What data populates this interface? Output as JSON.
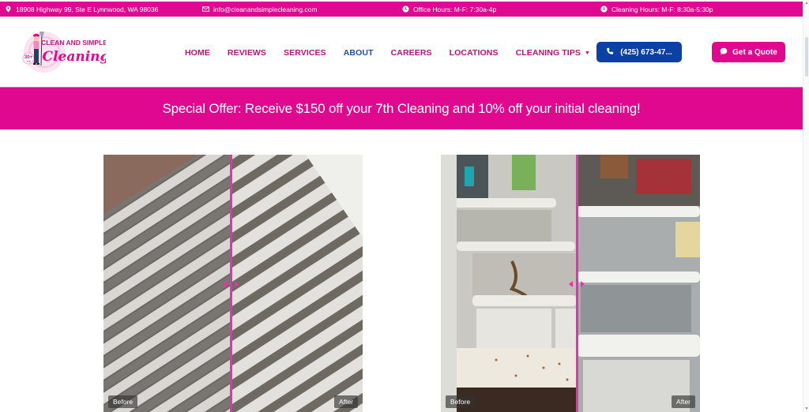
{
  "topbar": {
    "address": "18908 Highway 99, Ste E Lynnwood, WA 98036",
    "email": "info@cleanandsimplecleaning.com",
    "office_hours": "Office Hours: M-F: 7:30a-4p",
    "cleaning_hours": "Cleaning Hours: M-F: 8:30a-5:30p",
    "icons": {
      "address": "map-pin-icon",
      "email": "envelope-icon",
      "office_hours": "clock-icon",
      "cleaning_hours": "clock-icon"
    }
  },
  "logo": {
    "line1": "CLEAN AND SIMPLE",
    "line2": "Cleaning",
    "badge": "30+",
    "badge_sub": "Yrs"
  },
  "nav": {
    "items": [
      {
        "label": "HOME",
        "active": false
      },
      {
        "label": "REVIEWS",
        "active": false
      },
      {
        "label": "SERVICES",
        "active": false
      },
      {
        "label": "ABOUT",
        "active": true
      },
      {
        "label": "CAREERS",
        "active": false
      },
      {
        "label": "LOCATIONS",
        "active": false
      },
      {
        "label": "CLEANING TIPS",
        "active": false,
        "has_dropdown": true
      }
    ]
  },
  "header_buttons": {
    "phone_label": "(425) 673-47...",
    "phone_icon": "phone-icon",
    "quote_label": "Get a Quote",
    "quote_icon": "chat-bubble-icon"
  },
  "banner": {
    "text": "Special Offer: Receive $150 off your 7th Cleaning and 10% off your initial cleaning!"
  },
  "comparisons": [
    {
      "subject": "air vent grille",
      "before_label": "Before",
      "after_label": "After",
      "slider_position": 0.49
    },
    {
      "subject": "refrigerator interior",
      "before_label": "Before",
      "after_label": "After",
      "slider_position": 0.53
    }
  ],
  "colors": {
    "brand_pink": "#e0088f",
    "nav_text": "#b3157a",
    "nav_active": "#1f4fa8",
    "phone_button": "#0b40a5",
    "slider_divider": "#ec2fb2"
  }
}
